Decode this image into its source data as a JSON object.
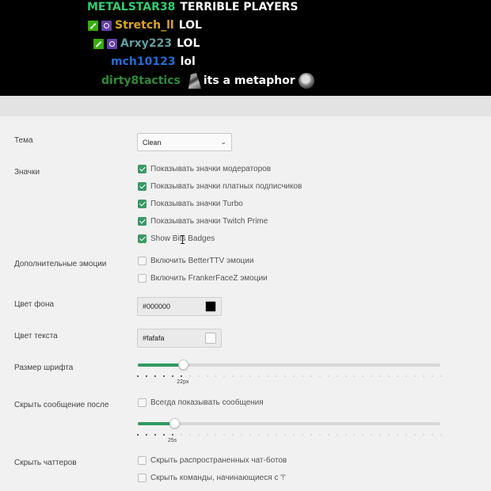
{
  "chat": [
    {
      "user": "METALSTAR38",
      "color": "#2fcd71",
      "badges": [],
      "message": "TERRIBLE PLAYERS"
    },
    {
      "user": "Stretch_ll",
      "color": "#daa520",
      "badges": [
        "moderator-icon",
        "prime-icon"
      ],
      "message": "LOL"
    },
    {
      "user": "Arxy223",
      "color": "#5f9ea0",
      "badges": [
        "moderator-icon",
        "prime-icon"
      ],
      "message": "LOL"
    },
    {
      "user": "mch10123",
      "color": "#1e6fd9",
      "badges": [],
      "message": "lol"
    },
    {
      "user": "dirty8tactics",
      "color": "#2e8b3a",
      "badges": [],
      "message": "its a metaphor"
    }
  ],
  "settings": {
    "theme": {
      "label": "Тема",
      "value": "Clean"
    },
    "badges": {
      "label": "Значки",
      "options": [
        {
          "text": "Показывать значки модераторов",
          "checked": true
        },
        {
          "text": "Показывать значки платных подписчиков",
          "checked": true
        },
        {
          "text": "Показывать значки Turbo",
          "checked": true
        },
        {
          "text": "Показывать значки Twitch Prime",
          "checked": true
        },
        {
          "text": "Show Bits Badges",
          "checked": true
        }
      ]
    },
    "emotes": {
      "label": "Дополнительные эмоции",
      "options": [
        {
          "text": "Включить BetterTTV эмоции",
          "checked": false
        },
        {
          "text": "Включить FrankerFaceZ эмоции",
          "checked": false
        }
      ]
    },
    "background": {
      "label": "Цвет фона",
      "value": "#000000",
      "swatch": "#000000"
    },
    "text_color": {
      "label": "Цвет текста",
      "value": "#fafafa",
      "swatch": "#fafafa"
    },
    "font_size": {
      "label": "Размер шрифта",
      "value_label": "22px",
      "fraction": 0.15
    },
    "hide_after": {
      "label": "Скрыть сообщение после",
      "always_show": "Всегда показывать сообщения",
      "always_checked": false,
      "value_label": "25s",
      "fraction": 0.12
    },
    "hide_chatters": {
      "label": "Скрыть чаттеров",
      "options": [
        {
          "text": "Скрыть распространенных чат-ботов",
          "checked": false
        },
        {
          "text": "Скрыть команды, начинающиеся с '!'",
          "checked": false
        }
      ]
    }
  },
  "colors": {
    "accent": "#2f9a63",
    "checkbox": "#3a9a63"
  }
}
